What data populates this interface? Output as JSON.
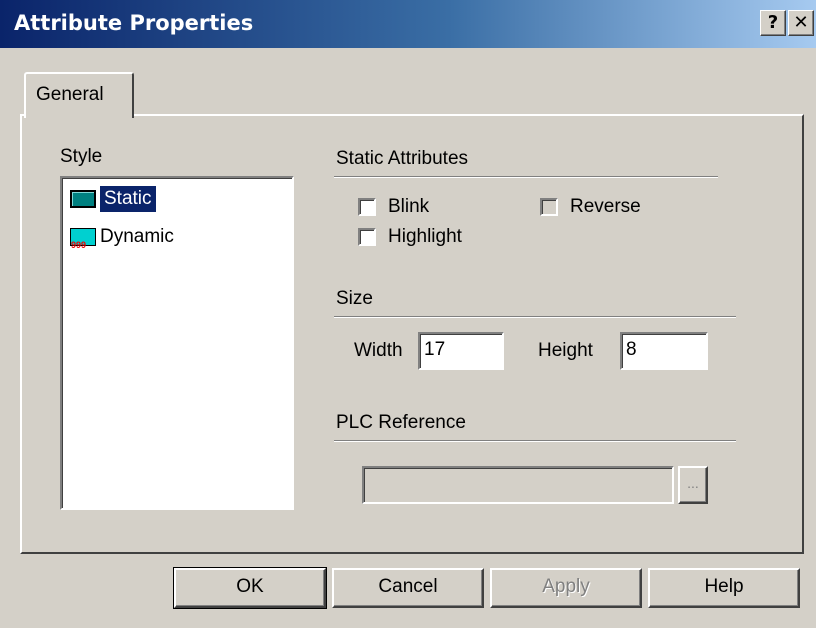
{
  "window": {
    "title": "Attribute Properties",
    "help_glyph": "?",
    "close_glyph": "✕"
  },
  "tabs": [
    {
      "label": "General"
    }
  ],
  "style": {
    "label": "Style",
    "items": [
      {
        "label": "Static",
        "icon": "static-style-icon",
        "selected": true
      },
      {
        "label": "Dynamic",
        "icon": "dynamic-style-icon",
        "selected": false
      }
    ]
  },
  "static_attributes": {
    "label": "Static Attributes",
    "blink": {
      "label": "Blink",
      "checked": false
    },
    "reverse": {
      "label": "Reverse",
      "checked": false,
      "enabled": false
    },
    "highlight": {
      "label": "Highlight",
      "checked": false
    }
  },
  "size": {
    "label": "Size",
    "width_label": "Width",
    "width_value": "17",
    "height_label": "Height",
    "height_value": "8"
  },
  "plc": {
    "label": "PLC Reference",
    "value": "",
    "browse_label": "..."
  },
  "buttons": {
    "ok": "OK",
    "cancel": "Cancel",
    "apply": "Apply",
    "help": "Help"
  }
}
